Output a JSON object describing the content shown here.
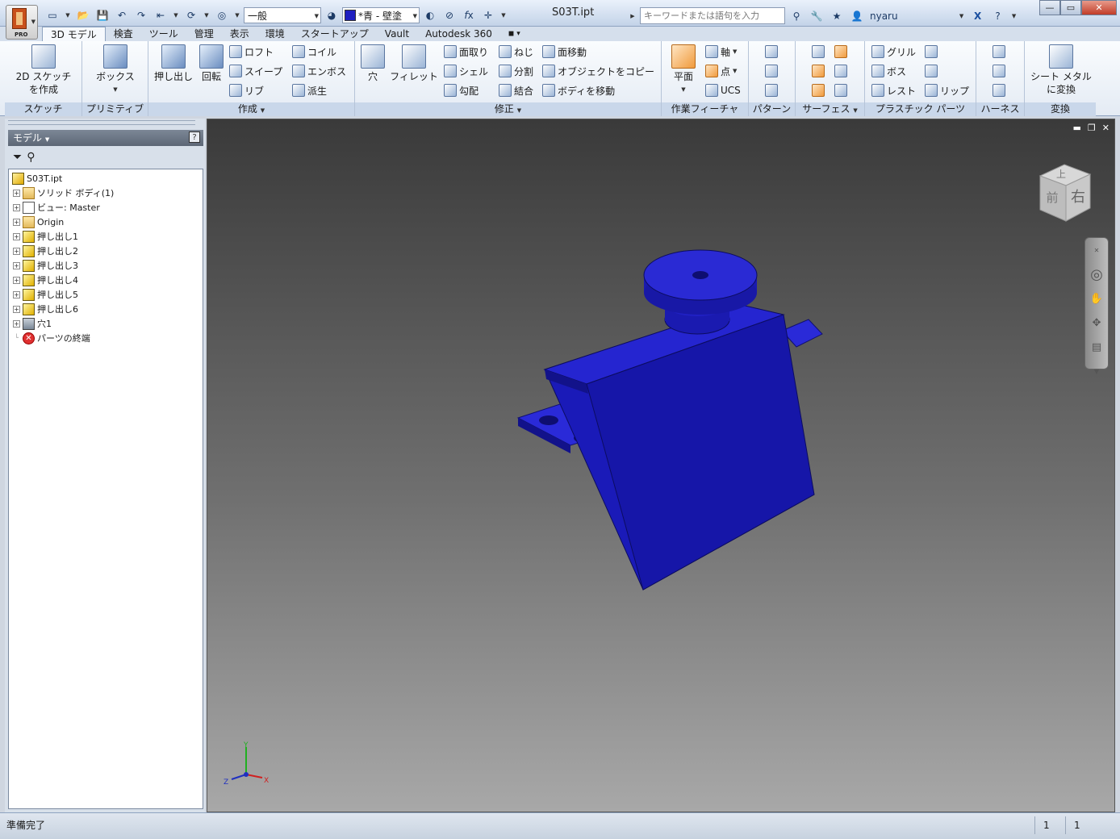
{
  "window": {
    "document_title": "S03T.ipt",
    "style_combo": "一般",
    "color_combo": "*青 - 壁塗",
    "search_placeholder": "キーワードまたは語句を入力",
    "user": "nyaru",
    "logo_text": "PRO"
  },
  "tabs": [
    "3D モデル",
    "検査",
    "ツール",
    "管理",
    "表示",
    "環境",
    "スタートアップ",
    "Vault",
    "Autodesk 360"
  ],
  "ribbon": {
    "sketch": {
      "title": "スケッチ",
      "button": "2D スケッチ",
      "button2": "を作成"
    },
    "primitive": {
      "title": "プリミティブ",
      "button": "ボックス"
    },
    "create": {
      "title": "作成",
      "extrude": "押し出し",
      "revolve": "回転",
      "loft": "ロフト",
      "sweep": "スイープ",
      "rib": "リブ",
      "coil": "コイル",
      "emboss": "エンボス",
      "derive": "派生"
    },
    "modify": {
      "title": "修正",
      "hole": "穴",
      "fillet": "フィレット",
      "chamfer": "面取り",
      "shell": "シェル",
      "draft": "勾配",
      "thread": "ねじ",
      "split": "分割",
      "combine": "結合",
      "move_face": "面移動",
      "copy_object": "オブジェクトをコピー",
      "move_body": "ボディを移動"
    },
    "work": {
      "title": "作業フィーチャ",
      "plane": "平面",
      "axis": "軸",
      "point": "点",
      "ucs": "UCS"
    },
    "pattern": {
      "title": "パターン"
    },
    "surface": {
      "title": "サーフェス"
    },
    "plastic": {
      "title": "プラスチック パーツ",
      "grill": "グリル",
      "boss": "ボス",
      "rest": "レスト",
      "lip": "リップ"
    },
    "harness": {
      "title": "ハーネス"
    },
    "convert": {
      "title": "変換",
      "button": "シート メタル",
      "button2": "に変換"
    }
  },
  "browser": {
    "title": "モデル",
    "help": "?",
    "tree": [
      {
        "label": "S03T.ipt",
        "kind": "root",
        "expand": false
      },
      {
        "label": "ソリッド ボディ(1)",
        "kind": "folder",
        "expand": true
      },
      {
        "label": "ビュー: Master",
        "kind": "view",
        "expand": true
      },
      {
        "label": "Origin",
        "kind": "folder",
        "expand": true
      },
      {
        "label": "押し出し1",
        "kind": "feature",
        "expand": true
      },
      {
        "label": "押し出し2",
        "kind": "feature",
        "expand": true
      },
      {
        "label": "押し出し3",
        "kind": "feature",
        "expand": true
      },
      {
        "label": "押し出し4",
        "kind": "feature",
        "expand": true
      },
      {
        "label": "押し出し5",
        "kind": "feature",
        "expand": true
      },
      {
        "label": "押し出し6",
        "kind": "feature",
        "expand": true
      },
      {
        "label": "穴1",
        "kind": "hole",
        "expand": true
      },
      {
        "label": "パーツの終端",
        "kind": "end",
        "expand": false
      }
    ]
  },
  "viewcube": {
    "top": "上",
    "front": "前",
    "right": "右"
  },
  "triad": {
    "x": "X",
    "y": "Y",
    "z": "Z"
  },
  "status": {
    "text": "準備完了",
    "cell1": "1",
    "cell2": "1"
  },
  "colors": {
    "body": "#1f1fc0",
    "accent": "#c8501c"
  }
}
